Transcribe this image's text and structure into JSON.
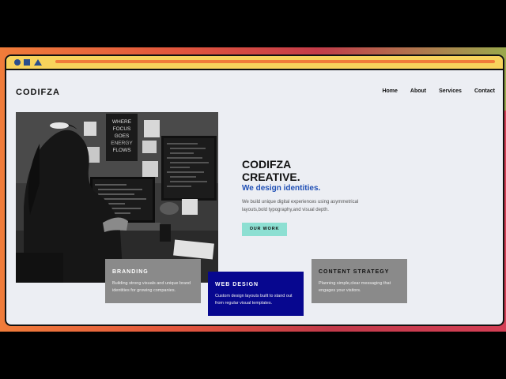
{
  "site": {
    "logo": "CODIFZA",
    "nav": [
      "Home",
      "About",
      "Services",
      "Contact"
    ]
  },
  "hero": {
    "title_line1": "CODIFZA",
    "title_line2": "CREATIVE.",
    "subtitle": "We design identities.",
    "description": "We build unique digital experiences using asymmetrical layouts,bold typography,and visual depth.",
    "cta_label": "OUR WORK",
    "photo_poster_lines": [
      "WHERE",
      "FOCUS",
      "GOES",
      "ENERGY",
      "FLOWS"
    ]
  },
  "services": [
    {
      "title": "BRANDING",
      "desc": "Building strong visuals and unique brand identities for growing companies."
    },
    {
      "title": "WEB DESIGN",
      "desc": "Custom design layouts built to stand out from regular visual templates."
    },
    {
      "title": "CONTENT STRATEGY",
      "desc": "Planning simple,clear messaging that engages your visitors."
    }
  ],
  "colors": {
    "accent_blue": "#1f4fb5",
    "cta_teal": "#8ddfd2",
    "card_gray": "#8a8a8a",
    "card_navy": "#07078f",
    "titlebar_yellow": "#f7d35c",
    "titlebar_orange": "#f07c3a"
  }
}
